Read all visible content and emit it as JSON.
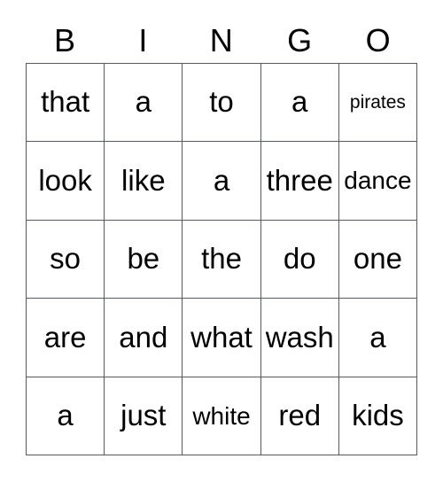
{
  "card": {
    "headers": [
      "B",
      "I",
      "N",
      "G",
      "O"
    ],
    "rows": [
      [
        {
          "text": "that",
          "size": "normal"
        },
        {
          "text": "a",
          "size": "normal"
        },
        {
          "text": "to",
          "size": "normal"
        },
        {
          "text": "a",
          "size": "normal"
        },
        {
          "text": "pirates",
          "size": "xs"
        }
      ],
      [
        {
          "text": "look",
          "size": "normal"
        },
        {
          "text": "like",
          "size": "normal"
        },
        {
          "text": "a",
          "size": "normal"
        },
        {
          "text": "three",
          "size": "normal"
        },
        {
          "text": "dance",
          "size": "sm"
        }
      ],
      [
        {
          "text": "so",
          "size": "normal"
        },
        {
          "text": "be",
          "size": "normal"
        },
        {
          "text": "the",
          "size": "normal"
        },
        {
          "text": "do",
          "size": "normal"
        },
        {
          "text": "one",
          "size": "normal"
        }
      ],
      [
        {
          "text": "are",
          "size": "normal"
        },
        {
          "text": "and",
          "size": "normal"
        },
        {
          "text": "what",
          "size": "normal"
        },
        {
          "text": "wash",
          "size": "normal"
        },
        {
          "text": "a",
          "size": "normal"
        }
      ],
      [
        {
          "text": "a",
          "size": "normal"
        },
        {
          "text": "just",
          "size": "normal"
        },
        {
          "text": "white",
          "size": "sm"
        },
        {
          "text": "red",
          "size": "normal"
        },
        {
          "text": "kids",
          "size": "normal"
        }
      ]
    ],
    "colors": {
      "grid_line": "#555a5e",
      "text": "#000000",
      "background": "#ffffff"
    }
  }
}
